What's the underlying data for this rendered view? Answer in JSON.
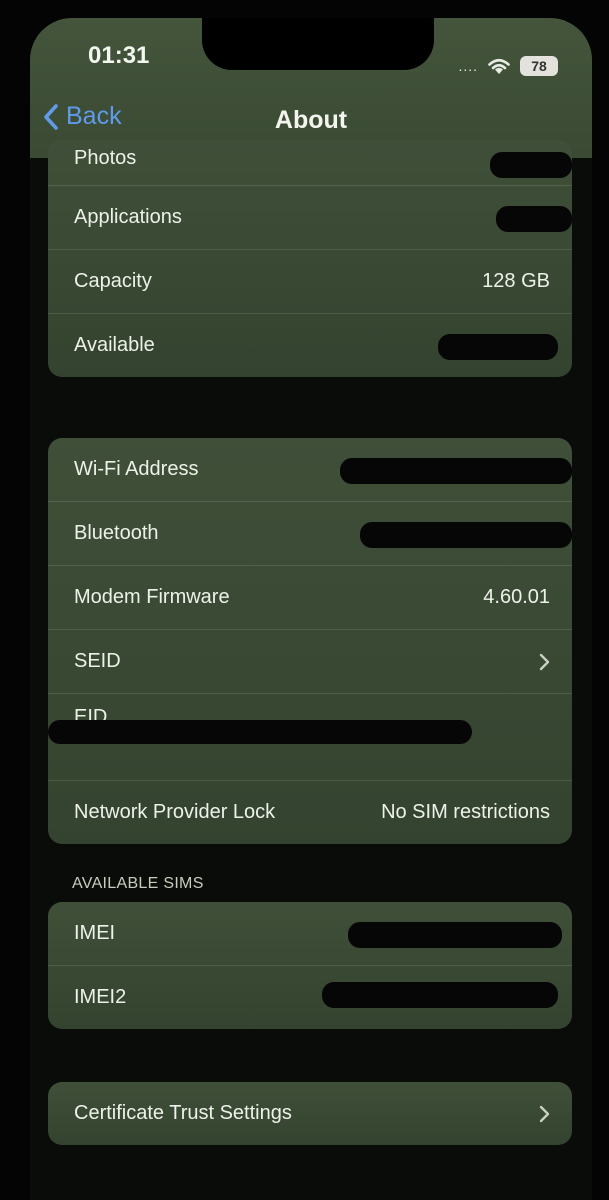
{
  "status_bar": {
    "time": "01:31",
    "signal": "....",
    "battery": "78"
  },
  "nav": {
    "back_label": "Back",
    "title": "About"
  },
  "storage_group": {
    "rows": [
      {
        "label": "Photos",
        "value": ""
      },
      {
        "label": "Applications",
        "value": ""
      },
      {
        "label": "Capacity",
        "value": "128 GB"
      },
      {
        "label": "Available",
        "value": ""
      }
    ]
  },
  "network_group": {
    "rows": [
      {
        "label": "Wi-Fi Address",
        "value": ""
      },
      {
        "label": "Bluetooth",
        "value": ""
      },
      {
        "label": "Modem Firmware",
        "value": "4.60.01"
      },
      {
        "label": "SEID",
        "value": ""
      },
      {
        "label": "EID",
        "value": ""
      },
      {
        "label": "Network Provider Lock",
        "value": "No SIM restrictions"
      }
    ]
  },
  "sims_section": {
    "header": "AVAILABLE SIMS",
    "rows": [
      {
        "label": "IMEI",
        "value": ""
      },
      {
        "label": "IMEI2",
        "value": ""
      }
    ]
  },
  "certificate_row": {
    "label": "Certificate Trust Settings"
  },
  "colors": {
    "accent": "#5f9bea",
    "group_bg": "#3d4d36",
    "background": "#030403"
  },
  "icons": [
    "chevron-left-icon",
    "chevron-right-icon",
    "wifi-icon",
    "battery-icon"
  ]
}
